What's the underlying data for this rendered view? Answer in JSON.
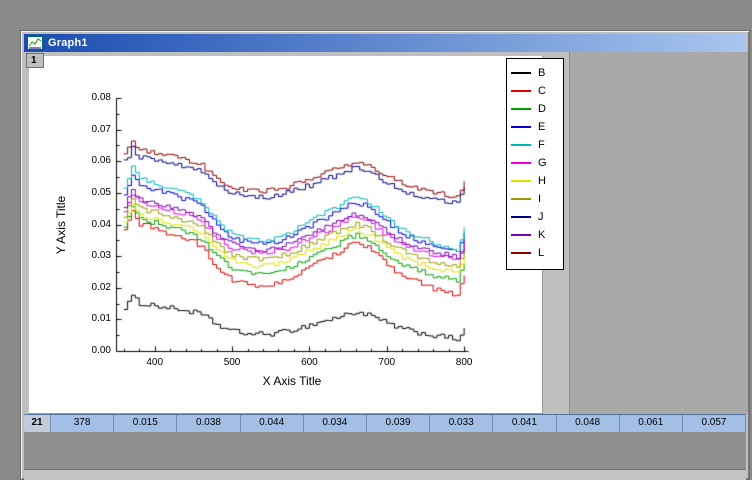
{
  "window": {
    "title": "Graph1",
    "page_tab": "1"
  },
  "icons": {
    "window_icon": "graph-icon"
  },
  "colors": {
    "desktop": "#8a8a8a",
    "window_face": "#bfbfbf",
    "titlebar_start": "#1a4cb0",
    "titlebar_end": "#a8c6ee",
    "workspace": "#a9a9a9",
    "page": "#ffffff",
    "row_bg": "#a3bfe6",
    "row_header_bg": "#c2cbdc"
  },
  "chart_data": {
    "type": "line",
    "title": "",
    "xlabel": "X Axis Title",
    "ylabel": "Y Axis Title",
    "xlim": [
      350,
      805
    ],
    "ylim": [
      0,
      0.08
    ],
    "x_tick_labels": [
      "400",
      "500",
      "600",
      "700",
      "800"
    ],
    "y_tick_labels": [
      "0.00",
      "0.01",
      "0.02",
      "0.03",
      "0.04",
      "0.05",
      "0.06",
      "0.07",
      "0.08"
    ],
    "x_minor_step": 20,
    "grid": false,
    "legend_position": "right",
    "profile_x_start": 360,
    "profile_x_step": 10,
    "profile": [
      0.8,
      1.0,
      0.88,
      0.86,
      0.84,
      0.8,
      0.78,
      0.76,
      0.73,
      0.7,
      0.65,
      0.55,
      0.45,
      0.38,
      0.33,
      0.3,
      0.28,
      0.27,
      0.27,
      0.28,
      0.3,
      0.33,
      0.37,
      0.41,
      0.45,
      0.5,
      0.54,
      0.58,
      0.62,
      0.68,
      0.7,
      0.67,
      0.62,
      0.55,
      0.48,
      0.42,
      0.37,
      0.33,
      0.3,
      0.27,
      0.24,
      0.22,
      0.2,
      0.17,
      0.38
    ],
    "noise_amplitude": 0.0008,
    "series": [
      {
        "name": "B",
        "color": "#000000",
        "offset": 0.001,
        "scale": 0.016
      },
      {
        "name": "C",
        "color": "#dd0000",
        "offset": 0.012,
        "scale": 0.032
      },
      {
        "name": "D",
        "color": "#00a000",
        "offset": 0.017,
        "scale": 0.028
      },
      {
        "name": "E",
        "color": "#0000dd",
        "offset": 0.026,
        "scale": 0.03
      },
      {
        "name": "F",
        "color": "#00b8b8",
        "offset": 0.0265,
        "scale": 0.032
      },
      {
        "name": "G",
        "color": "#e800e8",
        "offset": 0.024,
        "scale": 0.026
      },
      {
        "name": "H",
        "color": "#e0e000",
        "offset": 0.02,
        "scale": 0.026
      },
      {
        "name": "I",
        "color": "#9a9a00",
        "offset": 0.022,
        "scale": 0.026
      },
      {
        "name": "J",
        "color": "#000080",
        "offset": 0.043,
        "scale": 0.021
      },
      {
        "name": "K",
        "color": "#7a00b4",
        "offset": 0.025,
        "scale": 0.026
      },
      {
        "name": "L",
        "color": "#8b0000",
        "offset": 0.045,
        "scale": 0.021
      }
    ]
  },
  "worksheet_row": {
    "row_header": "21",
    "values": [
      "378",
      "0.015",
      "0.038",
      "0.044",
      "0.034",
      "0.039",
      "0.033",
      "0.041",
      "0.048",
      "0.061",
      "0.057"
    ]
  }
}
